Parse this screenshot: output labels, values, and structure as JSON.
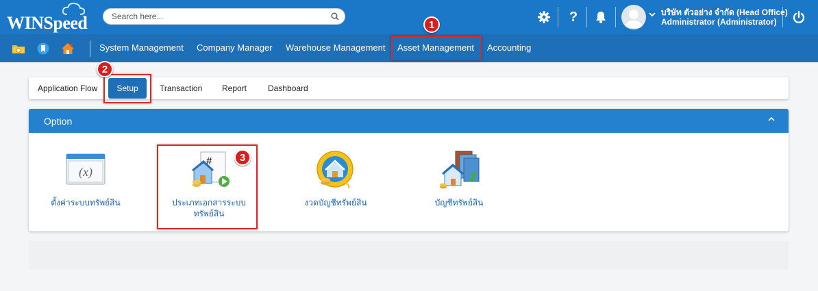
{
  "header": {
    "logo_text": "WINSpeed",
    "search_placeholder": "Search here...",
    "company": "บริษัท ตัวอย่าง จำกัด (Head Office)",
    "user": "Administrator (Administrator)",
    "icons": [
      "gear-icon",
      "help-icon",
      "bell-icon",
      "avatar",
      "chevron-down-icon",
      "power-icon"
    ]
  },
  "quick_icons": [
    "folder-icon",
    "bookmark-icon",
    "home-icon"
  ],
  "menu": {
    "items": [
      "System Management",
      "Company Manager",
      "Warehouse Management",
      "Asset Management",
      "Accounting"
    ],
    "active": "Asset Management"
  },
  "tabs": {
    "items": [
      "Application Flow",
      "Setup",
      "Transaction",
      "Report",
      "Dashboard"
    ],
    "active": "Setup"
  },
  "panel": {
    "title": "Option",
    "options": [
      {
        "label": "ตั้งค่าระบบทรัพย์สิน",
        "icon": "variable-window-icon"
      },
      {
        "label": "ประเภทเอกสารระบบ",
        "label2": "ทรัพย์สิน",
        "icon": "document-type-icon"
      },
      {
        "label": "งวดบัญชีทรัพย์สิน",
        "icon": "asset-period-icon"
      },
      {
        "label": "บัญชีทรัพย์สิน",
        "icon": "asset-account-icon"
      }
    ]
  },
  "annotations": {
    "step1": "1",
    "step2": "2",
    "step3": "3"
  },
  "colors": {
    "header": "#1b78c8",
    "menubar": "#1d6fb8",
    "panel_header": "#2481cf",
    "highlight": "#d42a2a",
    "link": "#1a64b5"
  }
}
